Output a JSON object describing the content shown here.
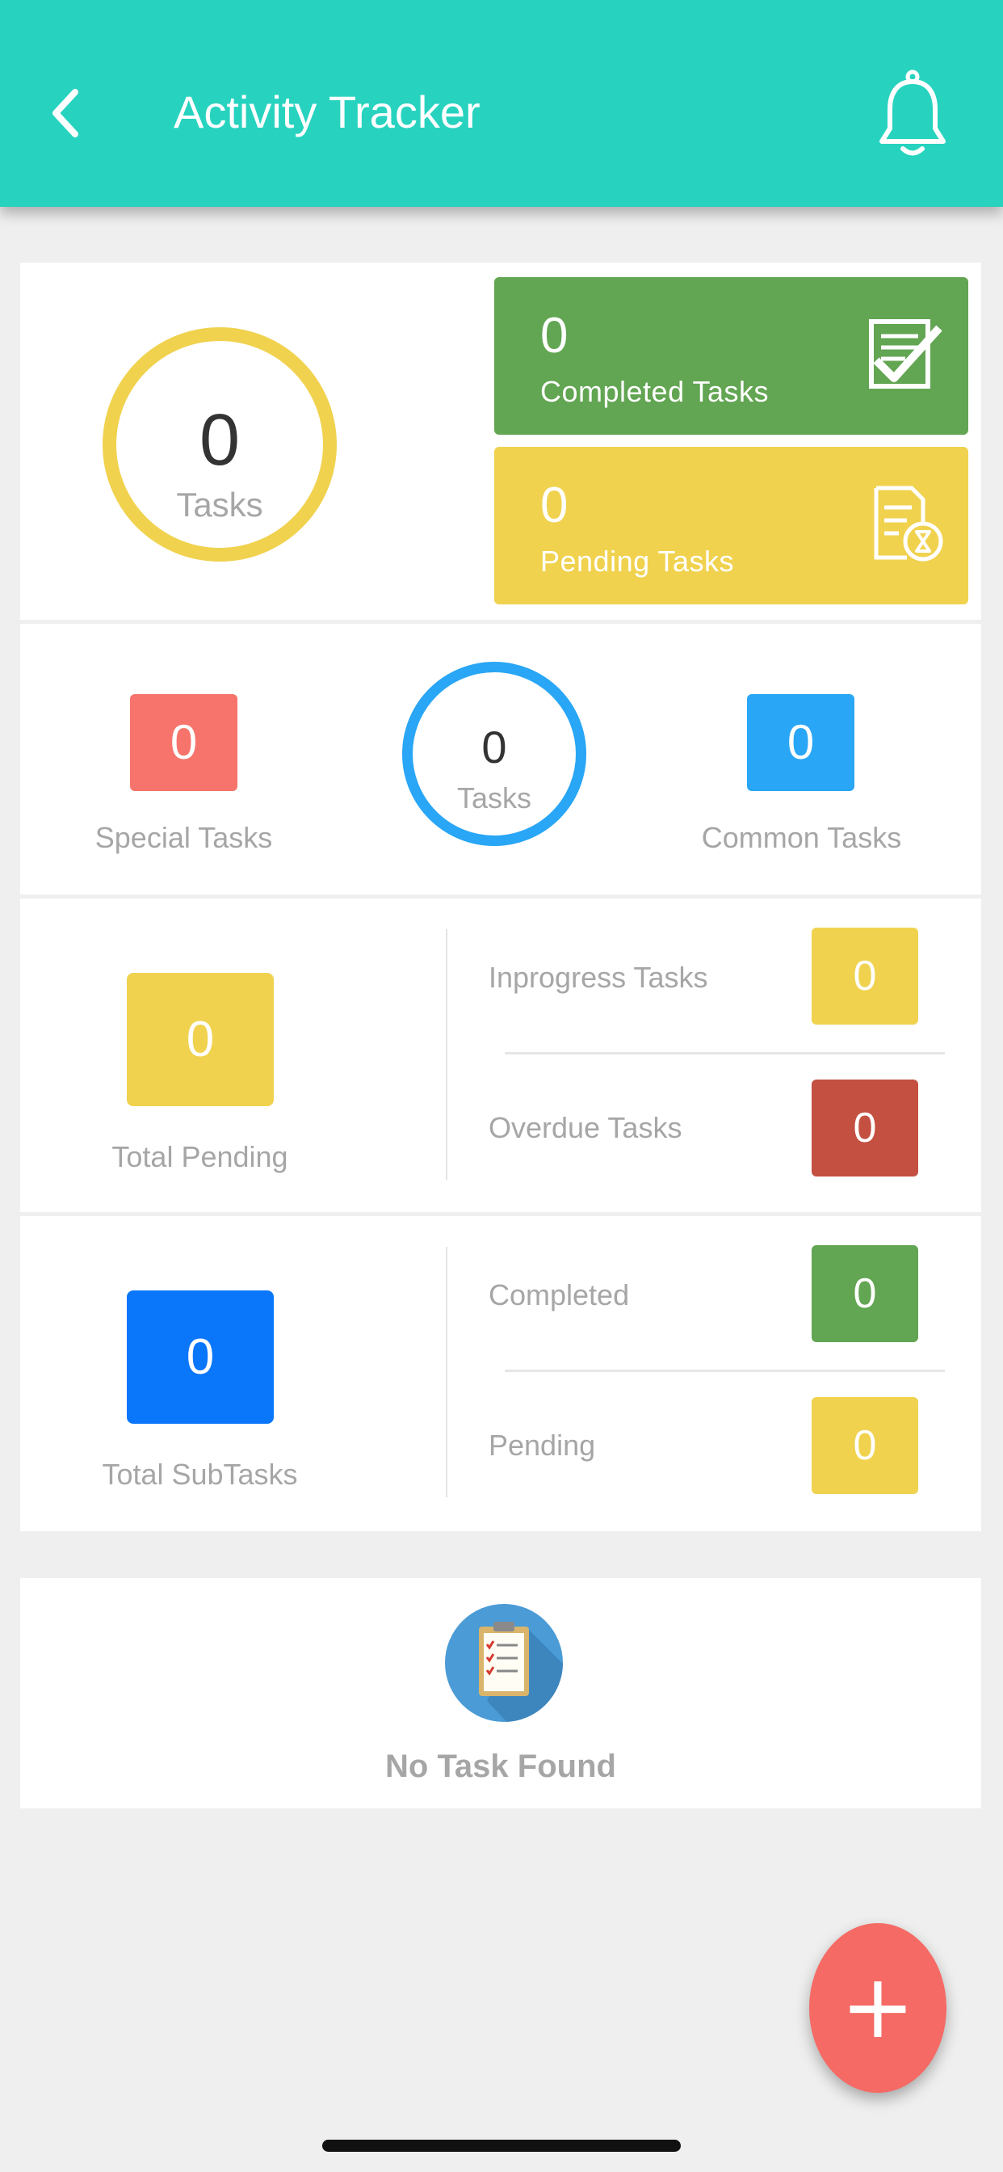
{
  "header": {
    "title": "Activity Tracker",
    "background": "#27d3bf",
    "icons": {
      "back": "chevron-left-icon",
      "notifications": "bell-icon"
    }
  },
  "summary": {
    "total_value": "0",
    "total_label": "Tasks",
    "completed": {
      "value": "0",
      "label": "Completed Tasks",
      "icon": "checklist-icon",
      "color": "#62a552"
    },
    "pending": {
      "value": "0",
      "label": "Pending Tasks",
      "icon": "document-hourglass-icon",
      "color": "#f0d24f"
    }
  },
  "categories": {
    "special": {
      "value": "0",
      "label": "Special Tasks",
      "color": "#f6746b"
    },
    "center": {
      "value": "0",
      "label": "Tasks"
    },
    "common": {
      "value": "0",
      "label": "Common Tasks",
      "color": "#29a6f5"
    }
  },
  "pending_breakdown": {
    "total": {
      "value": "0",
      "label": "Total Pending"
    },
    "inprogress": {
      "label": "Inprogress Tasks",
      "value": "0"
    },
    "overdue": {
      "label": "Overdue Tasks",
      "value": "0",
      "color": "#c45042"
    }
  },
  "subtasks": {
    "total": {
      "value": "0",
      "label": "Total SubTasks",
      "color": "#0a76fa"
    },
    "completed": {
      "label": "Completed",
      "value": "0"
    },
    "pending": {
      "label": "Pending",
      "value": "0"
    }
  },
  "empty_state": {
    "icon": "clipboard-checklist-icon",
    "text": "No Task Found"
  },
  "fab": {
    "icon": "plus-icon",
    "symbol": "+",
    "color": "#f56a64"
  }
}
